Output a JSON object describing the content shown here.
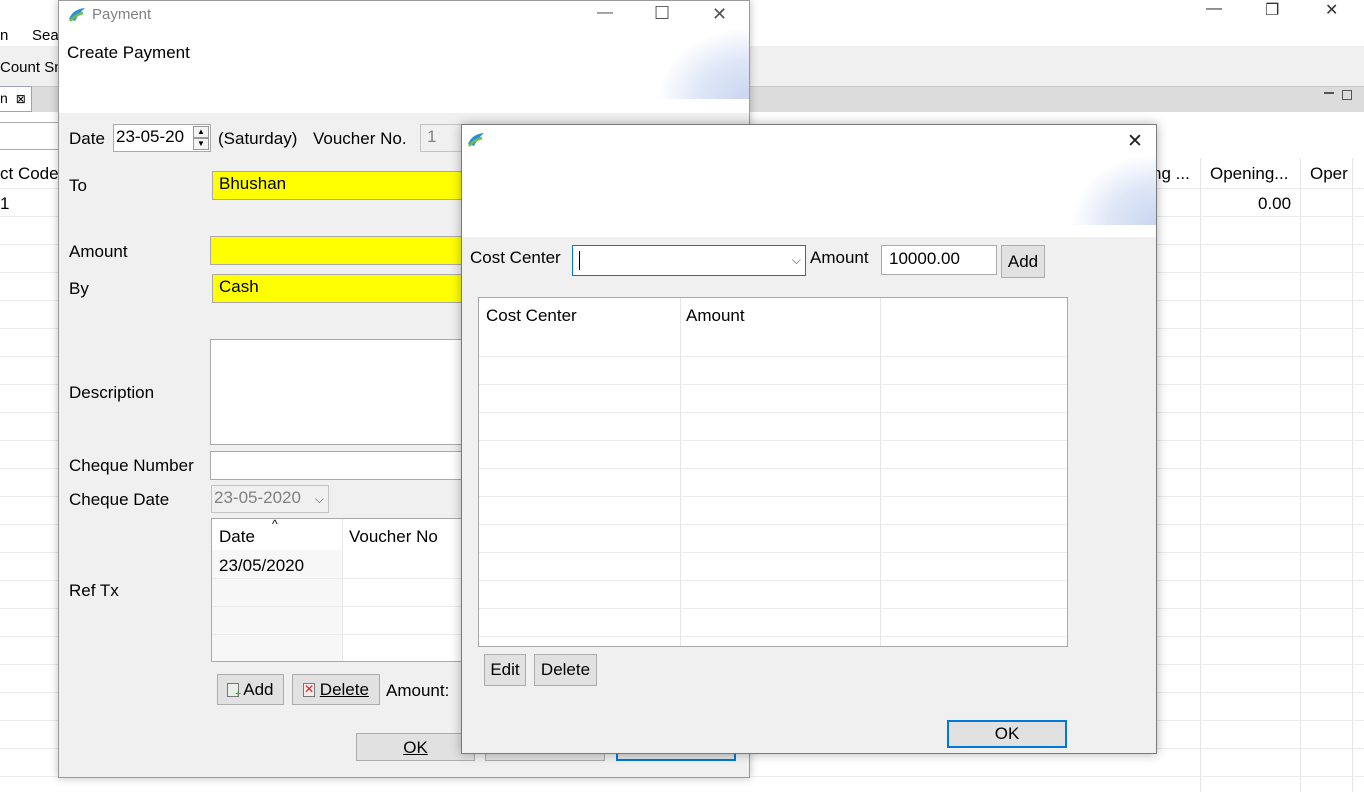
{
  "main_window": {
    "menu_partial": "n",
    "menu_search": "Sea",
    "toolbar_partial": "Count Sn",
    "tab_partial": "n",
    "tab_close": "⊠",
    "columns": {
      "col1": "ct Code",
      "col2": "ng ...",
      "col3": "Opening...",
      "col4": "Oper"
    },
    "row1": {
      "col1": "1",
      "col3": "0.00"
    },
    "controls": {
      "minimize": "—",
      "restore": "❐",
      "close": "✕"
    }
  },
  "payment_dialog": {
    "title": "Payment",
    "heading": "Create Payment",
    "date_label": "Date",
    "date_value": "23-05-20",
    "day_label": "(Saturday)",
    "voucher_label": "Voucher No.",
    "voucher_value": "1",
    "to_label": "To",
    "to_value": "Bhushan",
    "amount_label": "Amount",
    "amount_value": "",
    "by_label": "By",
    "by_value": "Cash",
    "description_label": "Description",
    "cheque_number_label": "Cheque Number",
    "cheque_date_label": "Cheque Date",
    "cheque_date_value": "23-05-2020",
    "ref_tx_label": "Ref Tx",
    "ref_table": {
      "headers": [
        "Date",
        "Voucher No"
      ],
      "rows": [
        [
          "23/05/2020",
          ""
        ]
      ]
    },
    "add_label": "Add",
    "delete_label": "Delete",
    "amount_footer_label": "Amount:",
    "ok_label": "OK",
    "controls": {
      "minimize": "—",
      "maximize": "☐",
      "close": "✕"
    }
  },
  "cost_center_dialog": {
    "close": "✕",
    "cost_center_label": "Cost Center",
    "cost_center_value": "",
    "amount_label": "Amount",
    "amount_value": "10000.00",
    "add_label": "Add",
    "table_headers": [
      "Cost Center",
      "Amount"
    ],
    "edit_label": "Edit",
    "delete_label": "Delete",
    "ok_label": "OK"
  },
  "colors": {
    "required_field": "#ffff00",
    "focus_border": "#0078d7"
  }
}
